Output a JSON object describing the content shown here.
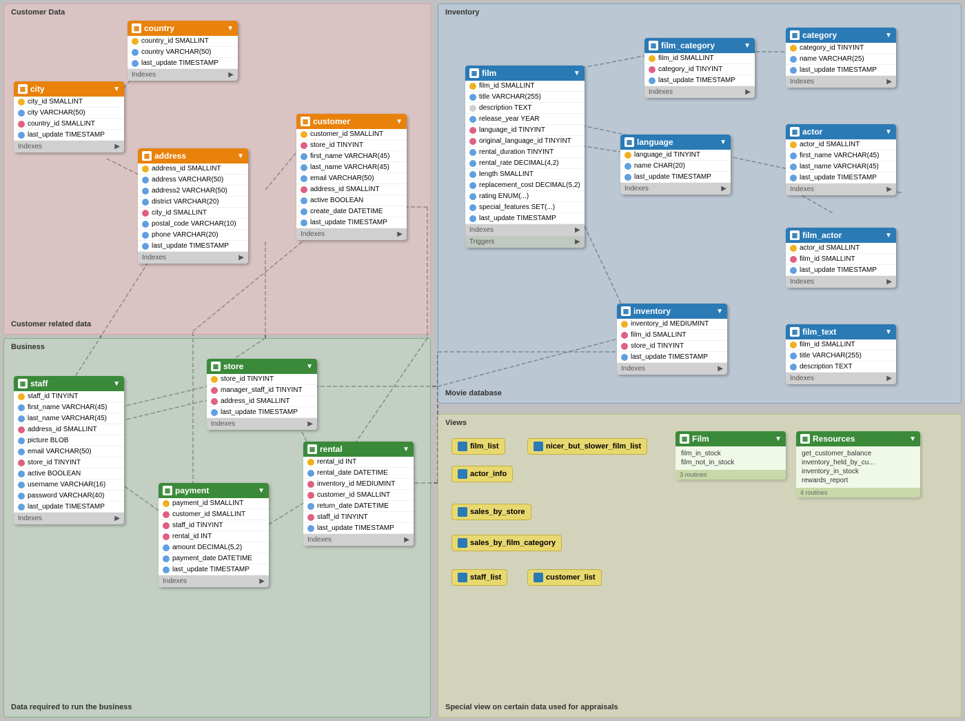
{
  "sections": {
    "customer": {
      "label": "Customer Data",
      "sublabel": "Customer related data"
    },
    "business": {
      "label": "Business",
      "sublabel": "Data required to run the business"
    },
    "inventory": {
      "label": "Inventory",
      "sublabel": "Movie database"
    },
    "views": {
      "label": "Views",
      "sublabel": "Special view on certain data used for appraisals"
    }
  },
  "tables": {
    "country": {
      "name": "country",
      "fields": [
        {
          "key": "key",
          "name": "country_id SMALLINT"
        },
        {
          "key": "fk",
          "name": "country VARCHAR(50)"
        },
        {
          "key": "fk",
          "name": "last_update TIMESTAMP"
        }
      ]
    },
    "city": {
      "name": "city",
      "fields": [
        {
          "key": "key",
          "name": "city_id SMALLINT"
        },
        {
          "key": "fk",
          "name": "city VARCHAR(50)"
        },
        {
          "key": "pink",
          "name": "country_id SMALLINT"
        },
        {
          "key": "fk",
          "name": "last_update TIMESTAMP"
        }
      ]
    },
    "address": {
      "name": "address",
      "fields": [
        {
          "key": "key",
          "name": "address_id SMALLINT"
        },
        {
          "key": "fk",
          "name": "address VARCHAR(50)"
        },
        {
          "key": "fk",
          "name": "address2 VARCHAR(50)"
        },
        {
          "key": "fk",
          "name": "district VARCHAR(20)"
        },
        {
          "key": "pink",
          "name": "city_id SMALLINT"
        },
        {
          "key": "fk",
          "name": "postal_code VARCHAR(10)"
        },
        {
          "key": "fk",
          "name": "phone VARCHAR(20)"
        },
        {
          "key": "fk",
          "name": "last_update TIMESTAMP"
        }
      ]
    },
    "customer": {
      "name": "customer",
      "fields": [
        {
          "key": "key",
          "name": "customer_id SMALLINT"
        },
        {
          "key": "pink",
          "name": "store_id TINYINT"
        },
        {
          "key": "fk",
          "name": "first_name VARCHAR(45)"
        },
        {
          "key": "fk",
          "name": "last_name VARCHAR(45)"
        },
        {
          "key": "fk",
          "name": "email VARCHAR(50)"
        },
        {
          "key": "pink",
          "name": "address_id SMALLINT"
        },
        {
          "key": "fk",
          "name": "active BOOLEAN"
        },
        {
          "key": "fk",
          "name": "create_date DATETIME"
        },
        {
          "key": "fk",
          "name": "last_update TIMESTAMP"
        }
      ]
    },
    "staff": {
      "name": "staff",
      "fields": [
        {
          "key": "key",
          "name": "staff_id TINYINT"
        },
        {
          "key": "fk",
          "name": "first_name VARCHAR(45)"
        },
        {
          "key": "fk",
          "name": "last_name VARCHAR(45)"
        },
        {
          "key": "pink",
          "name": "address_id SMALLINT"
        },
        {
          "key": "fk",
          "name": "picture BLOB"
        },
        {
          "key": "fk",
          "name": "email VARCHAR(50)"
        },
        {
          "key": "pink",
          "name": "store_id TINYINT"
        },
        {
          "key": "fk",
          "name": "active BOOLEAN"
        },
        {
          "key": "fk",
          "name": "username VARCHAR(16)"
        },
        {
          "key": "fk",
          "name": "password VARCHAR(40)"
        },
        {
          "key": "fk",
          "name": "last_update TIMESTAMP"
        }
      ]
    },
    "store": {
      "name": "store",
      "fields": [
        {
          "key": "key",
          "name": "store_id TINYINT"
        },
        {
          "key": "pink",
          "name": "manager_staff_id TINYINT"
        },
        {
          "key": "pink",
          "name": "address_id SMALLINT"
        },
        {
          "key": "fk",
          "name": "last_update TIMESTAMP"
        }
      ]
    },
    "payment": {
      "name": "payment",
      "fields": [
        {
          "key": "key",
          "name": "payment_id SMALLINT"
        },
        {
          "key": "pink",
          "name": "customer_id SMALLINT"
        },
        {
          "key": "pink",
          "name": "staff_id TINYINT"
        },
        {
          "key": "pink",
          "name": "rental_id INT"
        },
        {
          "key": "fk",
          "name": "amount DECIMAL(5,2)"
        },
        {
          "key": "fk",
          "name": "payment_date DATETIME"
        },
        {
          "key": "fk",
          "name": "last_update TIMESTAMP"
        }
      ]
    },
    "rental": {
      "name": "rental",
      "fields": [
        {
          "key": "key",
          "name": "rental_id INT"
        },
        {
          "key": "fk",
          "name": "rental_date DATETIME"
        },
        {
          "key": "pink",
          "name": "inventory_id MEDIUMINT"
        },
        {
          "key": "pink",
          "name": "customer_id SMALLINT"
        },
        {
          "key": "fk",
          "name": "return_date DATETIME"
        },
        {
          "key": "pink",
          "name": "staff_id TINYINT"
        },
        {
          "key": "fk",
          "name": "last_update TIMESTAMP"
        }
      ]
    },
    "film": {
      "name": "film",
      "fields": [
        {
          "key": "key",
          "name": "film_id SMALLINT"
        },
        {
          "key": "fk",
          "name": "title VARCHAR(255)"
        },
        {
          "key": "empty",
          "name": "description TEXT"
        },
        {
          "key": "fk",
          "name": "release_year YEAR"
        },
        {
          "key": "pink",
          "name": "language_id TINYINT"
        },
        {
          "key": "pink",
          "name": "original_language_id TINYINT"
        },
        {
          "key": "fk",
          "name": "rental_duration TINYINT"
        },
        {
          "key": "fk",
          "name": "rental_rate DECIMAL(4,2)"
        },
        {
          "key": "fk",
          "name": "length SMALLINT"
        },
        {
          "key": "fk",
          "name": "replacement_cost DECIMAL(5,2)"
        },
        {
          "key": "fk",
          "name": "rating ENUM(...)"
        },
        {
          "key": "fk",
          "name": "special_features SET(...)"
        },
        {
          "key": "fk",
          "name": "last_update TIMESTAMP"
        }
      ]
    },
    "film_category": {
      "name": "film_category",
      "fields": [
        {
          "key": "key",
          "name": "film_id SMALLINT"
        },
        {
          "key": "pink",
          "name": "category_id TINYINT"
        },
        {
          "key": "fk",
          "name": "last_update TIMESTAMP"
        }
      ]
    },
    "category": {
      "name": "category",
      "fields": [
        {
          "key": "key",
          "name": "category_id TINYINT"
        },
        {
          "key": "fk",
          "name": "name VARCHAR(25)"
        },
        {
          "key": "fk",
          "name": "last_update TIMESTAMP"
        }
      ]
    },
    "language": {
      "name": "language",
      "fields": [
        {
          "key": "key",
          "name": "language_id TINYINT"
        },
        {
          "key": "fk",
          "name": "name CHAR(20)"
        },
        {
          "key": "fk",
          "name": "last_update TIMESTAMP"
        }
      ]
    },
    "actor": {
      "name": "actor",
      "fields": [
        {
          "key": "key",
          "name": "actor_id SMALLINT"
        },
        {
          "key": "fk",
          "name": "first_name VARCHAR(45)"
        },
        {
          "key": "fk",
          "name": "last_name VARCHAR(45)"
        },
        {
          "key": "fk",
          "name": "last_update TIMESTAMP"
        }
      ]
    },
    "film_actor": {
      "name": "film_actor",
      "fields": [
        {
          "key": "key",
          "name": "actor_id SMALLINT"
        },
        {
          "key": "pink",
          "name": "film_id SMALLINT"
        },
        {
          "key": "fk",
          "name": "last_update TIMESTAMP"
        }
      ]
    },
    "inventory": {
      "name": "inventory",
      "fields": [
        {
          "key": "key",
          "name": "inventory_id MEDIUMINT"
        },
        {
          "key": "pink",
          "name": "film_id SMALLINT"
        },
        {
          "key": "pink",
          "name": "store_id TINYINT"
        },
        {
          "key": "fk",
          "name": "last_update TIMESTAMP"
        }
      ]
    },
    "film_text": {
      "name": "film_text",
      "fields": [
        {
          "key": "key",
          "name": "film_id SMALLINT"
        },
        {
          "key": "fk",
          "name": "title VARCHAR(255)"
        },
        {
          "key": "fk",
          "name": "description TEXT"
        }
      ]
    }
  },
  "views": {
    "standalone": [
      {
        "name": "film_list",
        "color": "yellow"
      },
      {
        "name": "nicer_but_slower_film_list",
        "color": "yellow"
      },
      {
        "name": "actor_info",
        "color": "yellow"
      },
      {
        "name": "sales_by_store",
        "color": "yellow"
      },
      {
        "name": "sales_by_film_category",
        "color": "yellow"
      },
      {
        "name": "staff_list",
        "color": "yellow"
      },
      {
        "name": "customer_list",
        "color": "yellow"
      }
    ],
    "film_table": {
      "name": "Film",
      "fields": [
        "film_in_stock",
        "film_not_in_stock"
      ],
      "footer": "3 routines"
    },
    "resources_table": {
      "name": "Resources",
      "fields": [
        "get_customer_balance",
        "inventory_held_by_cu...",
        "inventory_in_stock",
        "rewards_report"
      ],
      "footer": "4 routines"
    }
  },
  "colors": {
    "orange_header": "#e8820a",
    "blue_header": "#2a7ab5",
    "green_header": "#3a8a3a",
    "key_yellow": "#f0b020",
    "fk_blue": "#60a0e0",
    "fk_pink": "#e06080",
    "empty_gray": "#d0d0d0"
  }
}
